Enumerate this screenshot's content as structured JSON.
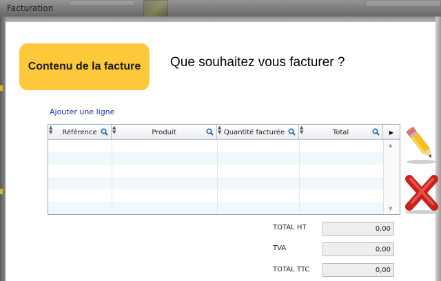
{
  "window": {
    "title": "Facturation"
  },
  "header": {
    "section_label": "Contenu de la facture",
    "question": "Que souhaitez vous facturer ?"
  },
  "actions": {
    "add_line": "Ajouter une ligne"
  },
  "table": {
    "columns": [
      "Référence",
      "Produit",
      "Quantité facturée",
      "Total"
    ],
    "rows": []
  },
  "totals": [
    {
      "label": "TOTAL HT",
      "value": "0,00"
    },
    {
      "label": "TVA",
      "value": "0,00"
    },
    {
      "label": "TOTAL TTC",
      "value": "0,00"
    }
  ],
  "colors": {
    "accent": "#fdc93a",
    "link": "#1a2fb8"
  },
  "icons": [
    "search-icon",
    "sort-icon",
    "pencil-icon",
    "cross-icon",
    "scroll-up-icon",
    "scroll-down-icon",
    "arrow-right-icon"
  ]
}
